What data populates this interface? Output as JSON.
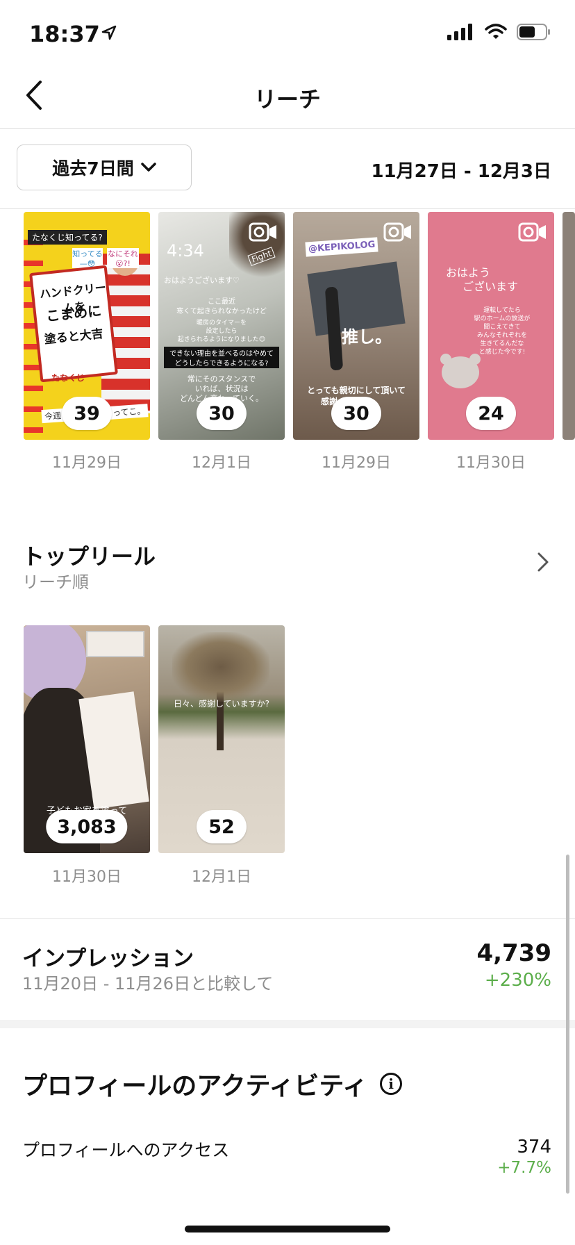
{
  "status": {
    "time": "18:37"
  },
  "header": {
    "title": "リーチ"
  },
  "filter": {
    "range_label": "過去7日間",
    "date_range": "11月27日 - 12月3日"
  },
  "stories": [
    {
      "count": "39",
      "date": "11月29日",
      "texts": [
        "たなくじ知ってる?",
        "知ってる—😳",
        "なにそれ😮?!",
        "ハンドクリームを",
        "こまめに",
        "塗ると大吉",
        "今週",
        "ってこ。",
        "たなくじ"
      ]
    },
    {
      "count": "30",
      "date": "12月1日",
      "texts": [
        "4:34",
        "Fight",
        "おはようございます♡",
        "ここ最近",
        "寒くて起きられなかったけど",
        "暖房のタイマーを",
        "設定したら",
        "起きられるようになりました😊",
        "できない理由を並べるのはやめて",
        "どうしたらできるようになる?",
        "常にそのスタンスで",
        "いれば、状況は",
        "どんどん変わっていく。"
      ]
    },
    {
      "count": "30",
      "date": "11月29日",
      "texts": [
        "@KEPIKOLOG",
        "推し。",
        "とっても親切にして頂いて",
        "感謝"
      ]
    },
    {
      "count": "24",
      "date": "11月30日",
      "texts": [
        "おはよう",
        "ございます",
        "運転してたら",
        "駅のホームの放送が",
        "聞こえてきて",
        "みんなそれぞれを",
        "生きてるんだな",
        "と感じた今です!"
      ]
    }
  ],
  "top_reels": {
    "title": "トップリール",
    "subtitle": "リーチ順"
  },
  "reels": [
    {
      "count": "3,083",
      "date": "11月30日",
      "caption": "子どもお家を塗って"
    },
    {
      "count": "52",
      "date": "12月1日",
      "caption": "日々、感謝していますか?"
    }
  ],
  "impressions": {
    "title": "インプレッション",
    "compare": "11月20日 - 11月26日と比較して",
    "value": "4,739",
    "delta": "+230%"
  },
  "activity": {
    "title": "プロフィールのアクティビティ",
    "info_glyph": "i",
    "rows": [
      {
        "label": "プロフィールへのアクセス",
        "value": "374",
        "delta": "+7.7%"
      }
    ]
  },
  "colors": {
    "positive": "#5cae4b",
    "muted": "#8e8e8e"
  }
}
